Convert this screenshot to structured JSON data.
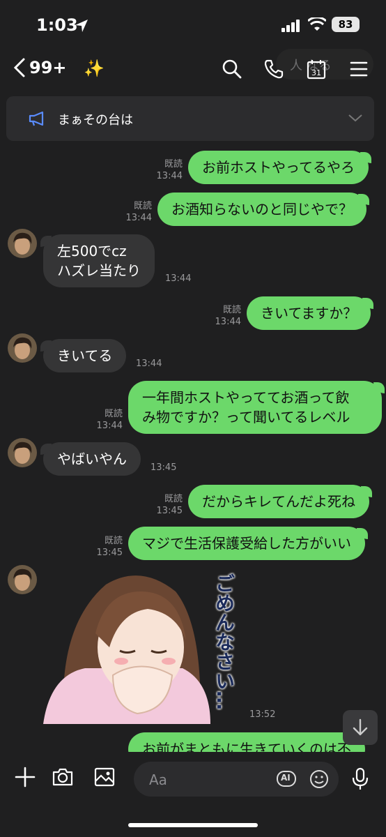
{
  "status": {
    "time": "1:03",
    "battery": "83"
  },
  "header": {
    "back_count": "99+",
    "ghost_text": "人 なる"
  },
  "announcement": {
    "text": "まぁその台は"
  },
  "messages": [
    {
      "text": "お前ホストやってるやろ",
      "read": "既読",
      "time": "13:44"
    },
    {
      "text": "お酒知らないのと同じやで？",
      "read": "既読",
      "time": "13:44"
    },
    {
      "line1": "左500でcz",
      "line2": "ハズレ当たり",
      "time": "13:44"
    },
    {
      "text": "きいてますか？",
      "read": "既読",
      "time": "13:44"
    },
    {
      "text": "きいてる",
      "time": "13:44"
    },
    {
      "line1": "一年間ホストやっててお酒って飲",
      "line2": "み物ですか？って聞いてるレベル",
      "read": "既読",
      "time": "13:44"
    },
    {
      "text": "やばいやん",
      "time": "13:45"
    },
    {
      "text": "だからキレてんだよ死ね",
      "read": "既読",
      "time": "13:45"
    },
    {
      "text": "マジで生活保護受給した方がいい",
      "read": "既読",
      "time": "13:45"
    },
    {
      "sticker_text": "ごめんなさい…",
      "time": "13:52"
    },
    {
      "text": "お前がまともに生きていくのは不"
    }
  ],
  "input": {
    "placeholder": "Aa",
    "ai_label": "AI"
  },
  "colors": {
    "my_bubble": "#6cd86a",
    "their_bubble": "#353536",
    "background": "#1f1f20"
  }
}
